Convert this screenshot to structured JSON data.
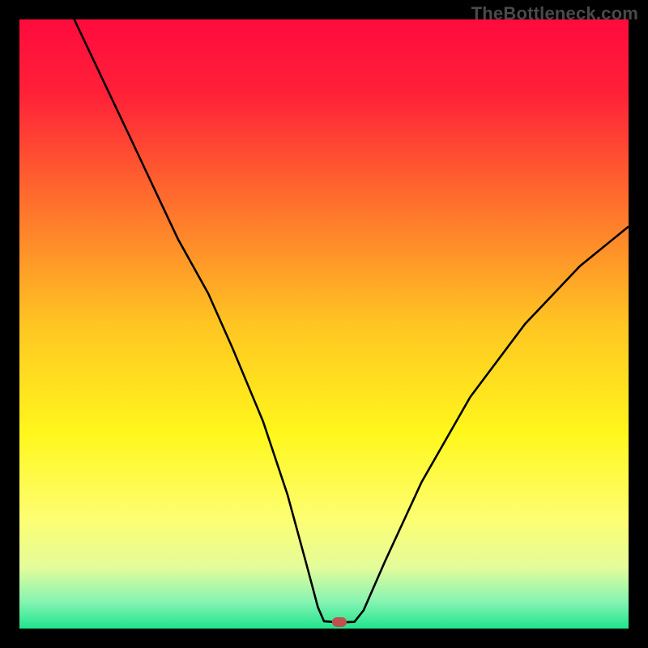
{
  "watermark": "TheBottleneck.com",
  "marker": {
    "fill": "#c1504d",
    "x_pct": 52.5,
    "y_pct": 99.0
  },
  "chart_data": {
    "type": "line",
    "title": "",
    "xlabel": "",
    "ylabel": "",
    "xlim": [
      0,
      100
    ],
    "ylim": [
      0,
      100
    ],
    "background_gradient": [
      {
        "pos": 0.0,
        "color": "#ff0b3d"
      },
      {
        "pos": 0.12,
        "color": "#ff2038"
      },
      {
        "pos": 0.3,
        "color": "#ff6f2d"
      },
      {
        "pos": 0.5,
        "color": "#ffc522"
      },
      {
        "pos": 0.68,
        "color": "#fff71c"
      },
      {
        "pos": 0.82,
        "color": "#fdfe72"
      },
      {
        "pos": 0.9,
        "color": "#e3fc9a"
      },
      {
        "pos": 0.955,
        "color": "#88f4b3"
      },
      {
        "pos": 1.0,
        "color": "#1fe48d"
      }
    ],
    "series": [
      {
        "name": "bottleneck-curve",
        "stroke": "#000000",
        "stroke_width": 2.6,
        "points": [
          {
            "x": 9.0,
            "y": 100.0
          },
          {
            "x": 18.0,
            "y": 81.0
          },
          {
            "x": 26.0,
            "y": 64.0
          },
          {
            "x": 31.0,
            "y": 55.0
          },
          {
            "x": 35.0,
            "y": 46.0
          },
          {
            "x": 40.0,
            "y": 34.0
          },
          {
            "x": 44.0,
            "y": 22.0
          },
          {
            "x": 47.0,
            "y": 11.0
          },
          {
            "x": 49.0,
            "y": 3.5
          },
          {
            "x": 50.0,
            "y": 1.2
          },
          {
            "x": 52.5,
            "y": 1.0
          },
          {
            "x": 55.0,
            "y": 1.1
          },
          {
            "x": 56.5,
            "y": 3.0
          },
          {
            "x": 60.0,
            "y": 11.0
          },
          {
            "x": 66.0,
            "y": 24.0
          },
          {
            "x": 74.0,
            "y": 38.0
          },
          {
            "x": 83.0,
            "y": 50.0
          },
          {
            "x": 92.0,
            "y": 59.5
          },
          {
            "x": 100.0,
            "y": 66.0
          }
        ]
      }
    ],
    "marker": {
      "x": 52.5,
      "y": 1.0,
      "shape": "pill",
      "color": "#c1504d"
    }
  }
}
